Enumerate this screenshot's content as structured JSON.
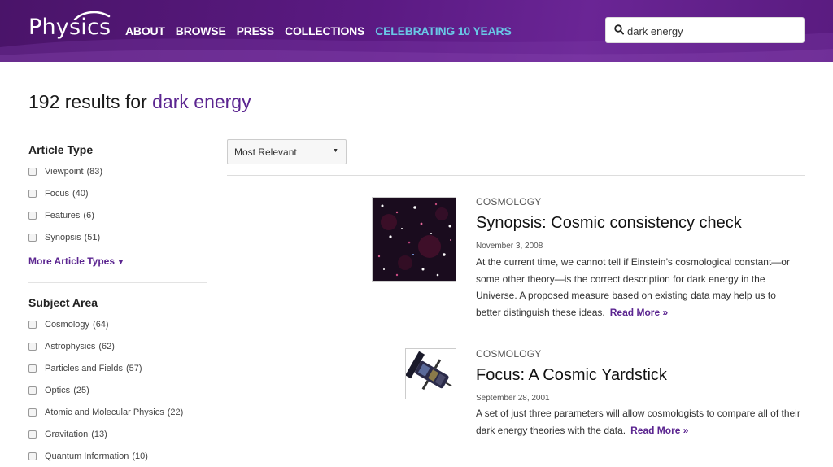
{
  "header": {
    "logo": "Physics",
    "nav": [
      {
        "label": "ABOUT"
      },
      {
        "label": "BROWSE"
      },
      {
        "label": "PRESS"
      },
      {
        "label": "COLLECTIONS"
      },
      {
        "label": "CELEBRATING 10 YEARS"
      }
    ],
    "search": {
      "value": "dark energy",
      "icon": "search-icon"
    }
  },
  "results": {
    "count_text": "192 results for ",
    "query": "dark energy"
  },
  "sidebar": {
    "article_type": {
      "title": "Article Type",
      "items": [
        {
          "label": "Viewpoint",
          "count": "(83)"
        },
        {
          "label": "Focus",
          "count": "(40)"
        },
        {
          "label": "Features",
          "count": "(6)"
        },
        {
          "label": "Synopsis",
          "count": "(51)"
        }
      ],
      "more": "More Article Types"
    },
    "subject_area": {
      "title": "Subject Area",
      "items": [
        {
          "label": "Cosmology",
          "count": "(64)"
        },
        {
          "label": "Astrophysics",
          "count": "(62)"
        },
        {
          "label": "Particles and Fields",
          "count": "(57)"
        },
        {
          "label": "Optics",
          "count": "(25)"
        },
        {
          "label": "Atomic and Molecular Physics",
          "count": "(22)"
        },
        {
          "label": "Gravitation",
          "count": "(13)"
        },
        {
          "label": "Quantum Information",
          "count": "(10)"
        }
      ]
    }
  },
  "sort": {
    "selected": "Most Relevant"
  },
  "items": [
    {
      "category": "COSMOLOGY",
      "title": "Synopsis: Cosmic consistency check",
      "date": "November 3, 2008",
      "desc": "At the current time, we cannot tell if Einstein’s cosmological constant—or some other theory—is the correct description for dark energy in the Universe. A proposed measure based on existing data may help us to better distinguish these ideas.",
      "read_more": "Read More »"
    },
    {
      "category": "COSMOLOGY",
      "title": "Focus: A Cosmic Yardstick",
      "date": "September 28, 2001",
      "desc": "A set of just three parameters will allow cosmologists to compare all of their dark energy theories with the data.",
      "read_more": "Read More »"
    }
  ],
  "colors": {
    "brand": "#5b1a83",
    "accent": "#69c8e6",
    "link": "#5b2590"
  }
}
